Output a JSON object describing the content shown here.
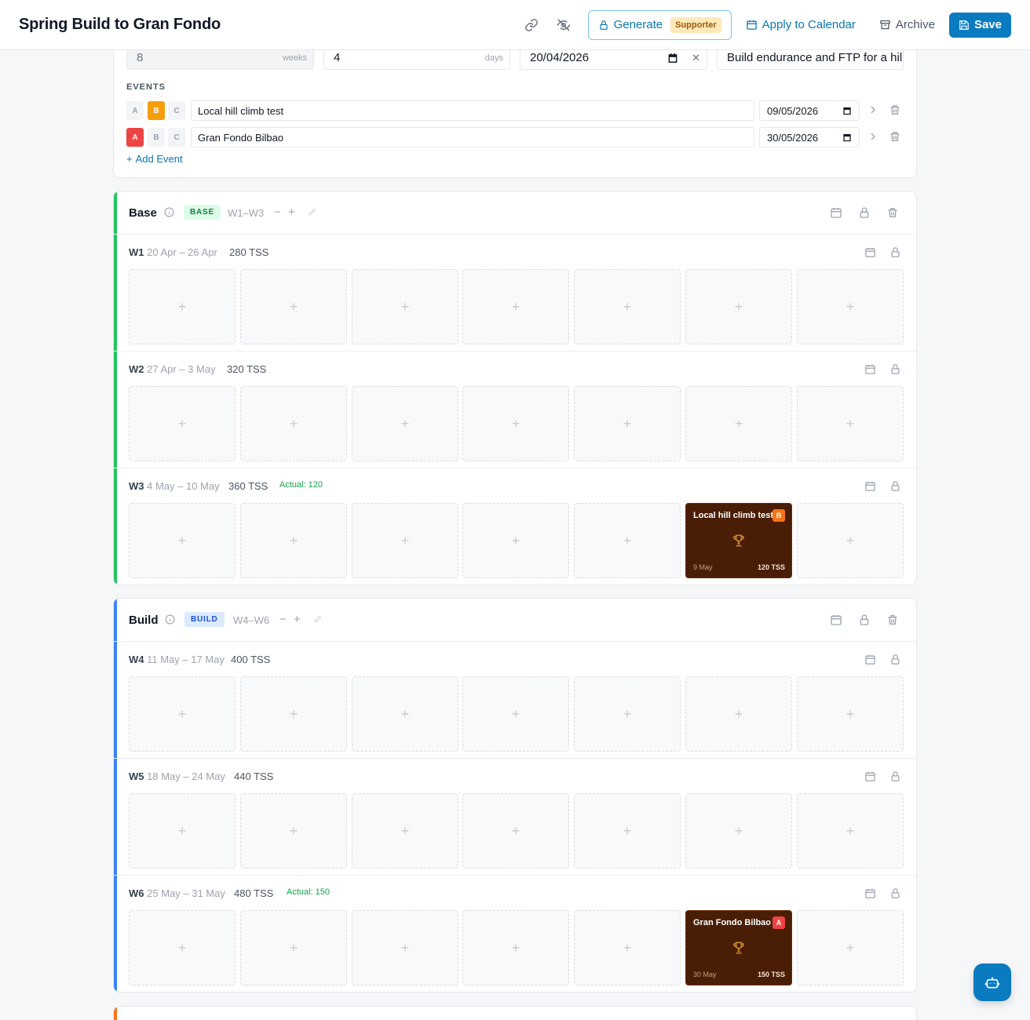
{
  "header": {
    "title": "Spring Build to Gran Fondo",
    "generate_label": "Generate",
    "supporter_badge": "Supporter",
    "apply_label": "Apply to Calendar",
    "archive_label": "Archive",
    "save_label": "Save"
  },
  "settings": {
    "weeks_value": "8",
    "weeks_unit": "weeks",
    "days_value": "4",
    "days_unit": "days",
    "start_date": "20/04/2026",
    "goal": "Build endurance and FTP for a hil",
    "events_label": "EVENTS",
    "add_event_label": "Add Event",
    "events": [
      {
        "name": "Local hill climb test",
        "date": "09/05/2026",
        "priority": "B"
      },
      {
        "name": "Gran Fondo Bilbao",
        "date": "30/05/2026",
        "priority": "A"
      }
    ]
  },
  "priority_letters": [
    "A",
    "B",
    "C"
  ],
  "colors": {
    "base_accent": "#22c55e",
    "build_accent": "#3b82f6",
    "next_accent": "#f97316",
    "priority_a": "#ef4444",
    "priority_b": "#f59e0b",
    "event_card": "#4a1e06",
    "primary": "#0a7bc0"
  },
  "phases": [
    {
      "name": "Base",
      "badge": "BASE",
      "range": "W1–W3",
      "weeks": [
        {
          "num": "W1",
          "dates": "20 Apr – 26 Apr",
          "tss": "280 TSS",
          "actual": ""
        },
        {
          "num": "W2",
          "dates": "27 Apr – 3 May",
          "tss": "320 TSS",
          "actual": ""
        },
        {
          "num": "W3",
          "dates": "4 May – 10 May",
          "tss": "360 TSS",
          "actual": "Actual: 120",
          "event": {
            "title": "Local hill climb test",
            "priority": "B",
            "date": "9 May",
            "tss": "120 TSS"
          }
        }
      ]
    },
    {
      "name": "Build",
      "badge": "BUILD",
      "range": "W4–W6",
      "weeks": [
        {
          "num": "W4",
          "dates": "11 May – 17 May",
          "tss": "400 TSS",
          "actual": ""
        },
        {
          "num": "W5",
          "dates": "18 May – 24 May",
          "tss": "440 TSS",
          "actual": ""
        },
        {
          "num": "W6",
          "dates": "25 May – 31 May",
          "tss": "480 TSS",
          "actual": "Actual: 150",
          "event": {
            "title": "Gran Fondo Bilbao",
            "priority": "A",
            "date": "30 May",
            "tss": "150 TSS"
          }
        }
      ]
    }
  ]
}
